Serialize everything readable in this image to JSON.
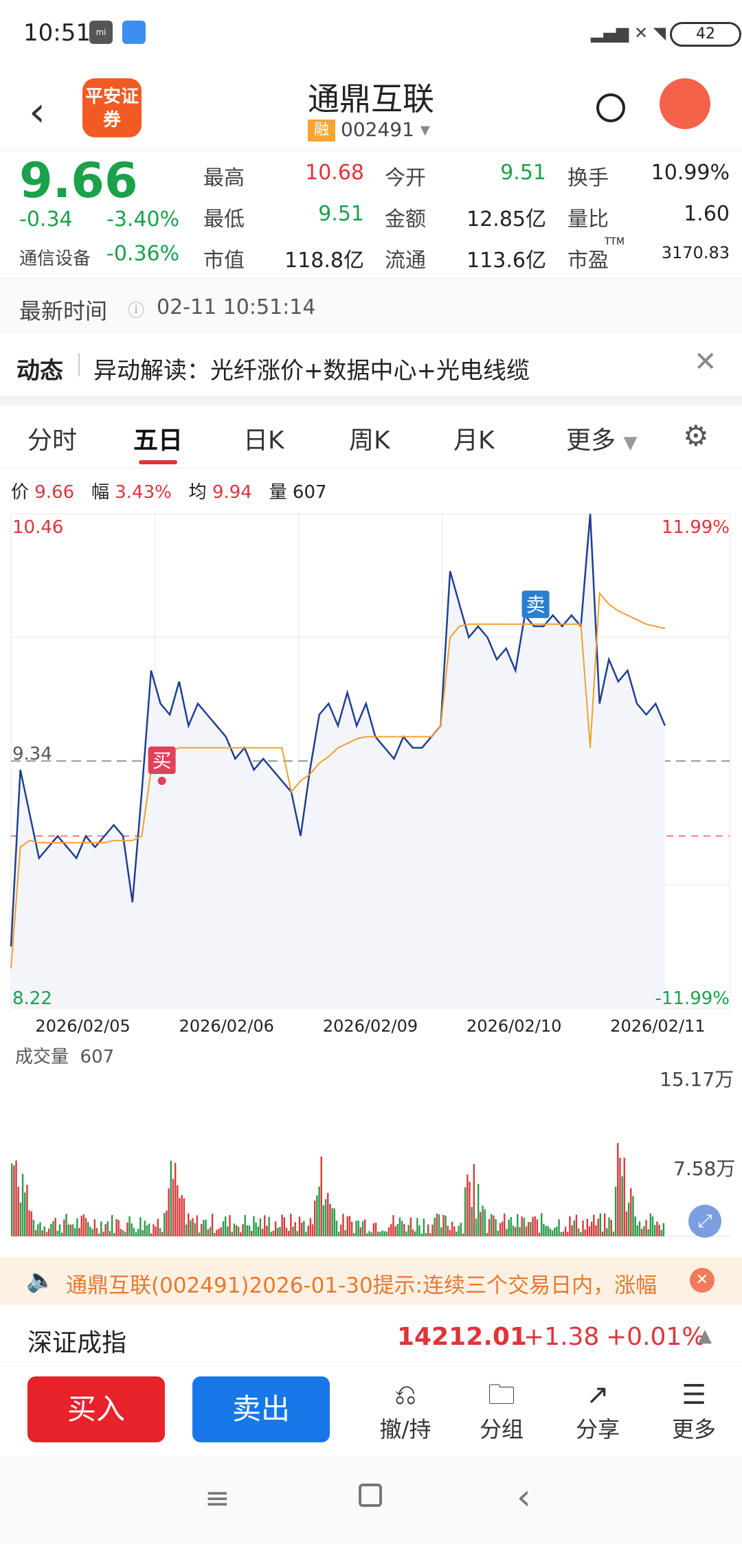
{
  "status_bar": {
    "time": "10:51",
    "battery": "42"
  },
  "header": {
    "title": "通鼎互联",
    "badge": "融",
    "code": "002491",
    "broker_logo": "平安证券"
  },
  "quote": {
    "price": "9.66",
    "change": "-0.34",
    "change_pct": "-3.40%",
    "sector_name": "通信设备",
    "sector_pct": "-0.36%",
    "fields": [
      {
        "label": "最高",
        "value": "10.68",
        "color": "red"
      },
      {
        "label": "今开",
        "value": "9.51",
        "color": "green"
      },
      {
        "label": "换手",
        "value": "10.99%",
        "color": "dark"
      },
      {
        "label": "最低",
        "value": "9.51",
        "color": "green"
      },
      {
        "label": "金额",
        "value": "12.85亿",
        "color": "dark"
      },
      {
        "label": "量比",
        "value": "1.60",
        "color": "dark"
      },
      {
        "label": "市值",
        "value": "118.8亿",
        "color": "dark"
      },
      {
        "label": "流通",
        "value": "113.6亿",
        "color": "dark"
      },
      {
        "label": "市盈",
        "value": "3170.83",
        "color": "dark",
        "sup": "TTM"
      }
    ]
  },
  "latest_time": {
    "label": "最新时间",
    "value": "02-11 10:51:14"
  },
  "dynamic": {
    "label": "动态",
    "text": "异动解读：光纤涨价+数据中心+光电线缆"
  },
  "tabs": [
    "分时",
    "五日",
    "日K",
    "周K",
    "月K",
    "更多"
  ],
  "legend": {
    "price_label": "价",
    "price": "9.66",
    "amp_label": "幅",
    "amp": "3.43%",
    "avg_label": "均",
    "avg": "9.94",
    "vol_label": "量",
    "vol": "607"
  },
  "chart_data": {
    "type": "line",
    "y_max": "10.46",
    "y_min": "8.22",
    "y_ref": "9.34",
    "pct_max": "11.99%",
    "pct_min": "-11.99%",
    "dates": [
      "2026/02/05",
      "2026/02/06",
      "2026/02/09",
      "2026/02/10",
      "2026/02/11"
    ],
    "buy_label": "买",
    "sell_label": "卖",
    "series": [
      {
        "values": [
          8.5,
          9.3,
          9.1,
          8.9,
          8.95,
          9.0,
          8.95,
          8.9,
          9.0,
          8.95,
          9.0,
          9.05,
          9.0,
          8.7,
          9.2,
          9.75,
          9.6,
          9.55,
          9.7,
          9.5,
          9.6,
          9.55,
          9.5,
          9.45,
          9.35,
          9.4,
          9.3,
          9.35,
          9.3,
          9.25,
          9.2,
          9.0,
          9.3,
          9.55,
          9.6,
          9.5,
          9.65,
          9.5,
          9.6,
          9.45,
          9.4,
          9.35,
          9.45,
          9.4,
          9.4,
          9.45,
          9.5,
          10.2,
          10.05,
          9.9,
          9.95,
          9.9,
          9.8,
          9.85,
          9.75,
          10.0,
          9.95,
          9.95,
          10.0,
          9.95,
          10.0,
          9.95,
          10.46,
          9.6,
          9.8,
          9.7,
          9.75,
          9.6,
          9.55,
          9.6,
          9.5
        ]
      },
      {
        "values": [
          8.4,
          8.95,
          8.98,
          8.97,
          8.97,
          8.97,
          8.97,
          8.97,
          8.97,
          8.97,
          8.97,
          8.98,
          8.98,
          8.98,
          9.0,
          9.3,
          9.35,
          9.38,
          9.4,
          9.4,
          9.4,
          9.4,
          9.4,
          9.4,
          9.4,
          9.4,
          9.4,
          9.4,
          9.4,
          9.4,
          9.2,
          9.25,
          9.28,
          9.33,
          9.36,
          9.4,
          9.42,
          9.44,
          9.45,
          9.45,
          9.45,
          9.45,
          9.45,
          9.45,
          9.45,
          9.45,
          9.5,
          9.9,
          9.95,
          9.96,
          9.96,
          9.96,
          9.96,
          9.96,
          9.96,
          9.96,
          9.96,
          9.96,
          9.96,
          9.96,
          9.96,
          9.96,
          9.4,
          10.1,
          10.05,
          10.02,
          10.0,
          9.98,
          9.96,
          9.95,
          9.94
        ]
      }
    ]
  },
  "volume": {
    "label": "成交量",
    "value": "607",
    "max": "15.17万",
    "mid": "7.58万"
  },
  "notice": {
    "text": "通鼎互联(002491)2026-01-30提示:连续三个交易日内，涨幅"
  },
  "index": {
    "name": "深证成指",
    "value": "14212.01",
    "change": "+1.38",
    "pct": "+0.01%"
  },
  "actions": {
    "buy": "买入",
    "sell": "卖出",
    "items": [
      {
        "label": "撤/持"
      },
      {
        "label": "分组"
      },
      {
        "label": "分享"
      },
      {
        "label": "更多"
      }
    ]
  }
}
